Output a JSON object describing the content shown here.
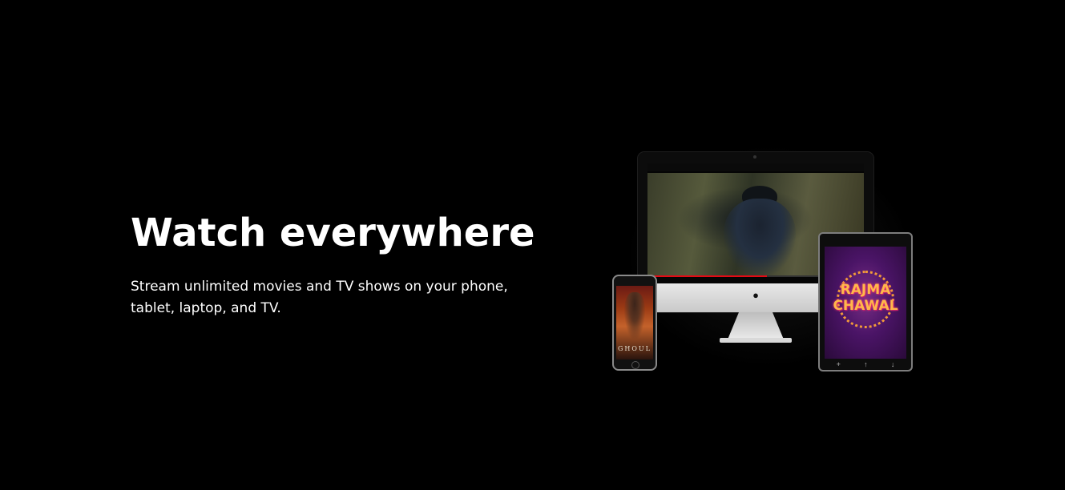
{
  "hero": {
    "headline": "Watch everywhere",
    "description": "Stream unlimited movies and TV shows on your phone, tablet, laptop, and TV."
  },
  "devices": {
    "phone": {
      "poster_title": "GHOUL"
    },
    "tablet": {
      "poster_title": "RAJMA CHAWAL"
    },
    "desktop": {
      "playback_progress": 0.55
    }
  },
  "colors": {
    "background": "#000000",
    "text": "#ffffff",
    "accent": "#e50914"
  },
  "icons": {
    "desktop_logo": "apple-logo-icon",
    "tablet_controls": [
      "add-icon",
      "like-icon",
      "download-icon"
    ]
  }
}
